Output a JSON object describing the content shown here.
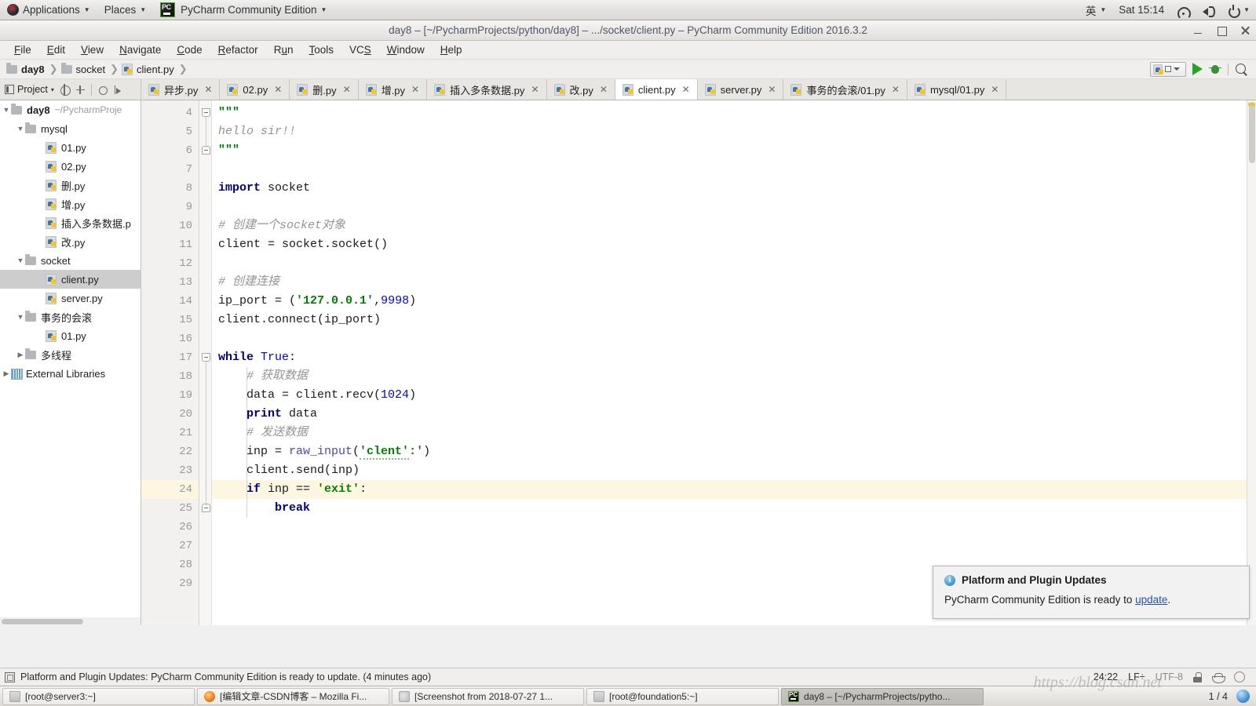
{
  "desktop": {
    "applications_label": "Applications",
    "places_label": "Places",
    "app_menu_label": "PyCharm Community Edition",
    "input_method": "英",
    "clock": "Sat 15:14",
    "icons": {
      "wifi": "wifi-icon",
      "volume": "volume-icon",
      "power": "power-icon"
    }
  },
  "window": {
    "title": "day8 – [~/PycharmProjects/python/day8] – .../socket/client.py – PyCharm Community Edition 2016.3.2",
    "buttons": {
      "minimize": "minimize-button",
      "maximize": "maximize-button",
      "close": "close-button"
    }
  },
  "menubar": {
    "items": [
      {
        "label": "File",
        "mnemonic": "F"
      },
      {
        "label": "Edit",
        "mnemonic": "E"
      },
      {
        "label": "View",
        "mnemonic": "V"
      },
      {
        "label": "Navigate",
        "mnemonic": "N"
      },
      {
        "label": "Code",
        "mnemonic": "C"
      },
      {
        "label": "Refactor",
        "mnemonic": "R"
      },
      {
        "label": "Run",
        "mnemonic": "u"
      },
      {
        "label": "Tools",
        "mnemonic": "T"
      },
      {
        "label": "VCS",
        "mnemonic": "S"
      },
      {
        "label": "Window",
        "mnemonic": "W"
      },
      {
        "label": "Help",
        "mnemonic": "H"
      }
    ]
  },
  "navbar": {
    "breadcrumb": [
      {
        "label": "day8",
        "icon": "folder-icon",
        "bold": true
      },
      {
        "label": "socket",
        "icon": "folder-icon",
        "bold": false
      },
      {
        "label": "client.py",
        "icon": "python-file-icon",
        "bold": false
      }
    ],
    "run_config_label": "",
    "run_button": "run-button",
    "debug_button": "debug-button",
    "search_button": "search-everywhere-button"
  },
  "toolwindow_strip": {
    "project_label": "Project",
    "buttons": [
      "locate-icon",
      "collapse-all-icon",
      "settings-icon",
      "hide-icon"
    ]
  },
  "editor_tabs": [
    {
      "label": "异步.py",
      "active": false
    },
    {
      "label": "02.py",
      "active": false
    },
    {
      "label": "删.py",
      "active": false
    },
    {
      "label": "增.py",
      "active": false
    },
    {
      "label": "插入多条数据.py",
      "active": false
    },
    {
      "label": "改.py",
      "active": false
    },
    {
      "label": "client.py",
      "active": true
    },
    {
      "label": "server.py",
      "active": false
    },
    {
      "label": "事务的会滚/01.py",
      "active": false
    },
    {
      "label": "mysql/01.py",
      "active": false
    }
  ],
  "project_tree": [
    {
      "label": "day8",
      "path": "~/PycharmProje",
      "type": "folder",
      "indent": 0,
      "arrow": "▼",
      "bold": true,
      "selected": false
    },
    {
      "label": "mysql",
      "type": "folder",
      "indent": 1,
      "arrow": "▼",
      "bold": false,
      "selected": false
    },
    {
      "label": "01.py",
      "type": "python",
      "indent": 2,
      "arrow": "",
      "bold": false,
      "selected": false
    },
    {
      "label": "02.py",
      "type": "python",
      "indent": 2,
      "arrow": "",
      "bold": false,
      "selected": false
    },
    {
      "label": "删.py",
      "type": "python",
      "indent": 2,
      "arrow": "",
      "bold": false,
      "selected": false
    },
    {
      "label": "增.py",
      "type": "python",
      "indent": 2,
      "arrow": "",
      "bold": false,
      "selected": false
    },
    {
      "label": "插入多条数据.p",
      "type": "python",
      "indent": 2,
      "arrow": "",
      "bold": false,
      "selected": false
    },
    {
      "label": "改.py",
      "type": "python",
      "indent": 2,
      "arrow": "",
      "bold": false,
      "selected": false
    },
    {
      "label": "socket",
      "type": "folder",
      "indent": 1,
      "arrow": "▼",
      "bold": false,
      "selected": false
    },
    {
      "label": "client.py",
      "type": "python",
      "indent": 2,
      "arrow": "",
      "bold": false,
      "selected": true
    },
    {
      "label": "server.py",
      "type": "python",
      "indent": 2,
      "arrow": "",
      "bold": false,
      "selected": false
    },
    {
      "label": "事务的会滚",
      "type": "folder",
      "indent": 1,
      "arrow": "▼",
      "bold": false,
      "selected": false
    },
    {
      "label": "01.py",
      "type": "python",
      "indent": 2,
      "arrow": "",
      "bold": false,
      "selected": false
    },
    {
      "label": "多线程",
      "type": "folder",
      "indent": 1,
      "arrow": "▶",
      "bold": false,
      "selected": false
    },
    {
      "label": "External Libraries",
      "type": "libs",
      "indent": 0,
      "arrow": "▶",
      "bold": false,
      "selected": false
    }
  ],
  "editor": {
    "caret_line": 24,
    "first_visible_line": 4,
    "lines": [
      {
        "n": 4,
        "html": "<span class=\"str\">\"\"\"</span>"
      },
      {
        "n": 5,
        "html": "<span class=\"cmt\">hello sir!!</span>"
      },
      {
        "n": 6,
        "html": "<span class=\"str\">\"\"\"</span>"
      },
      {
        "n": 7,
        "html": ""
      },
      {
        "n": 8,
        "html": "<span class=\"kw\">import</span> socket"
      },
      {
        "n": 9,
        "html": ""
      },
      {
        "n": 10,
        "html": "<span class=\"cmt\"># 创建一个socket对象</span>"
      },
      {
        "n": 11,
        "html": "client = socket.socket()"
      },
      {
        "n": 12,
        "html": ""
      },
      {
        "n": 13,
        "html": "<span class=\"cmt\"># 创建连接</span>"
      },
      {
        "n": 14,
        "html": "ip_port = (<span class=\"str\">'127.0.0.1'</span>,<span class=\"num\">9998</span>)"
      },
      {
        "n": 15,
        "html": "client.connect(ip_port)"
      },
      {
        "n": 16,
        "html": ""
      },
      {
        "n": 17,
        "html": "<span class=\"kw\">while</span> <span class=\"num\">True</span>:"
      },
      {
        "n": 18,
        "html": "    <span class=\"cmt\"># 获取数据</span>"
      },
      {
        "n": 19,
        "html": "    data = client.recv(<span class=\"num\">1024</span>)"
      },
      {
        "n": 20,
        "html": "    <span class=\"kw\">print</span> data"
      },
      {
        "n": 21,
        "html": "    <span class=\"cmt\"># 发送数据</span>"
      },
      {
        "n": 22,
        "html": "    inp = <span class=\"bi\">raw_input</span>(<span class=\"str\"><span class=\"spell\">'clent'</span>:'</span>)"
      },
      {
        "n": 23,
        "html": "    client.send(inp)"
      },
      {
        "n": 24,
        "html": "    <span class=\"kw\">if</span> inp == <span class=\"str\">'exit'</span>:"
      },
      {
        "n": 25,
        "html": "        <span class=\"kw\">break</span>"
      },
      {
        "n": 26,
        "html": ""
      },
      {
        "n": 27,
        "html": ""
      },
      {
        "n": 28,
        "html": ""
      },
      {
        "n": 29,
        "html": ""
      }
    ],
    "plain_lines": [
      "\"\"\"",
      "hello sir!!",
      "\"\"\"",
      "",
      "import socket",
      "",
      "# 创建一个socket对象",
      "client = socket.socket()",
      "",
      "# 创建连接",
      "ip_port = ('127.0.0.1',9998)",
      "client.connect(ip_port)",
      "",
      "while True:",
      "    # 获取数据",
      "    data = client.recv(1024)",
      "    print data",
      "    # 发送数据",
      "    inp = raw_input('clent:')",
      "    client.send(inp)",
      "    if inp == 'exit':",
      "        break"
    ]
  },
  "notification": {
    "icon": "info-icon",
    "title": "Platform and Plugin Updates",
    "body_prefix": "PyCharm Community Edition is ready to ",
    "link": "update",
    "body_suffix": "."
  },
  "statusbar": {
    "icon": "event-log-icon",
    "message": "Platform and Plugin Updates: PyCharm Community Edition is ready to update. (4 minutes ago)",
    "caret_position": "24:22",
    "line_separator": "LF÷",
    "encoding": "UTF-8",
    "lock_icon": "lock-icon",
    "hat_icon": "hector-icon",
    "circle_icon": "memory-indicator-icon"
  },
  "taskbar": {
    "windows": [
      {
        "label": "[root@server3:~]",
        "icon": "terminal-icon",
        "active": false
      },
      {
        "label": "[编辑文章-CSDN博客 – Mozilla Fi...",
        "icon": "firefox-icon",
        "active": false
      },
      {
        "label": "[Screenshot from 2018-07-27 1...",
        "icon": "image-icon",
        "active": false
      },
      {
        "label": "[root@foundation5:~]",
        "icon": "terminal-icon",
        "active": false
      },
      {
        "label": "day8 – [~/PycharmProjects/pytho...",
        "icon": "pycharm-icon",
        "active": true
      }
    ],
    "workspace": "1 / 4",
    "tray_icon": "notification-icon"
  },
  "watermark": "https://blog.csdn.net"
}
